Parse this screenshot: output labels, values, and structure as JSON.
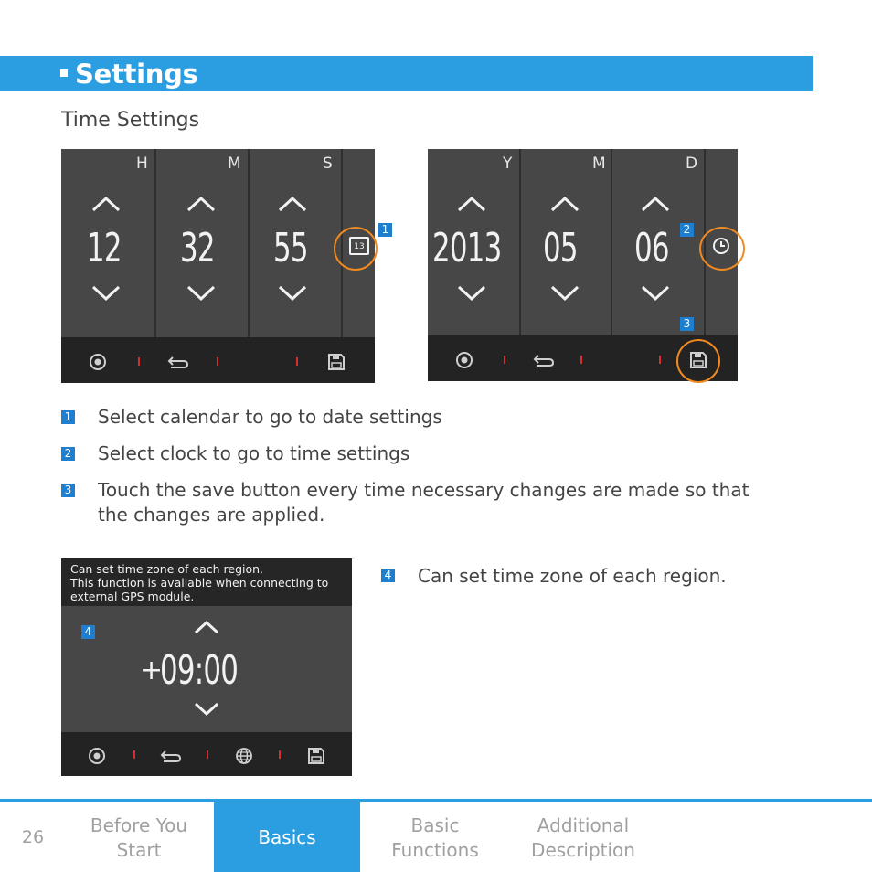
{
  "header": {
    "title": "Settings"
  },
  "subtitle": "Time Settings",
  "time_screen": {
    "columns": [
      {
        "label": "H",
        "value": "12"
      },
      {
        "label": "M",
        "value": "32"
      },
      {
        "label": "S",
        "value": "55"
      }
    ],
    "calendar_icon_text": "13"
  },
  "date_screen": {
    "columns": [
      {
        "label": "Y",
        "value": "2013"
      },
      {
        "label": "M",
        "value": "05"
      },
      {
        "label": "D",
        "value": "06"
      }
    ]
  },
  "badges": [
    "1",
    "2",
    "3",
    "4"
  ],
  "notes": [
    {
      "num": "1",
      "text": "Select calendar to go to date settings"
    },
    {
      "num": "2",
      "text": "Select clock to go to time settings"
    },
    {
      "num": "3",
      "text": "Touch the save button every time necessary changes are made so that"
    },
    {
      "num": "",
      "text": "the changes are applied."
    },
    {
      "num": "4",
      "text": "Can set time zone of each region."
    }
  ],
  "timezone_screen": {
    "info_lines": [
      "Can set time zone of each region.",
      "This function is available when connecting to",
      "external GPS module."
    ],
    "sign": "+",
    "value": "09:00"
  },
  "footer": {
    "page_number": "26",
    "tabs": [
      {
        "line1": "Before You",
        "line2": "Start"
      },
      {
        "line1": "Basics",
        "line2": ""
      },
      {
        "line1": "Basic",
        "line2": "Functions"
      },
      {
        "line1": "Additional",
        "line2": "Description"
      }
    ],
    "active_tab": "Basics"
  },
  "colors": {
    "accent": "#2a9ee0",
    "highlight": "#f08a20",
    "badge": "#1e7fd0"
  }
}
